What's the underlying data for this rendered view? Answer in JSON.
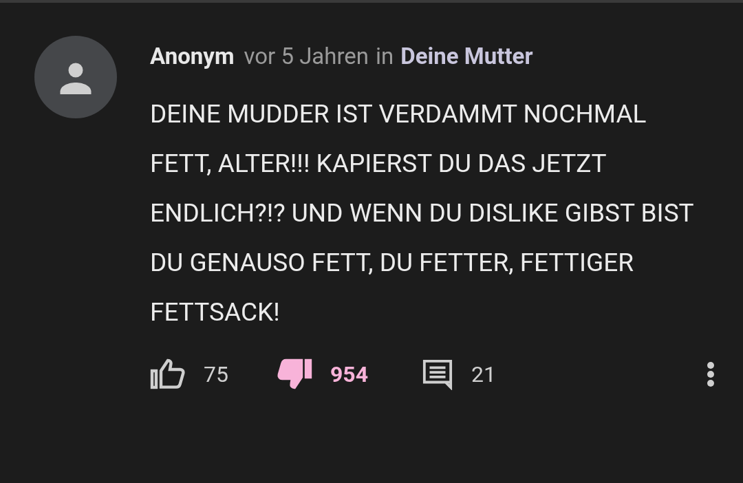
{
  "comment": {
    "author": "Anonym",
    "time": "vor 5 Jahren",
    "in_word": "in",
    "channel": "Deine Mutter",
    "text": "DEINE MUDDER IST VERDAMMT NOCHMAL FETT, ALTER!!! KAPIERST DU DAS JETZT ENDLICH?!? UND WENN DU DISLIKE GIBST BIST DU GENAUSO FETT, DU FETTER, FETTIGER FETTSACK!",
    "likes": "75",
    "liked": false,
    "dislikes": "954",
    "disliked": true,
    "replies": "21"
  }
}
